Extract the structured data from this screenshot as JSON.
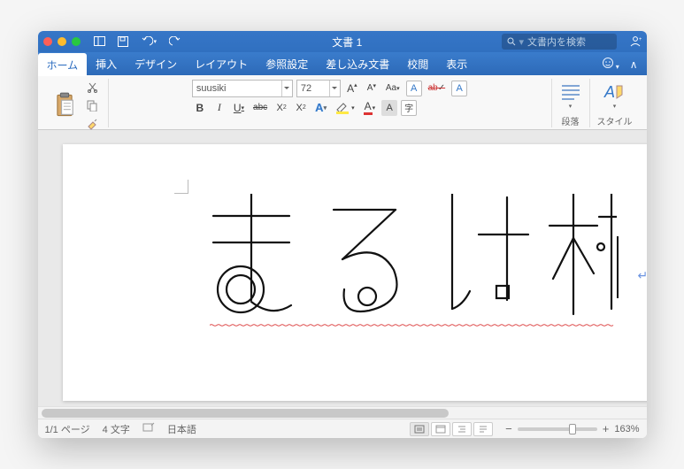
{
  "titlebar": {
    "title": "文書 1",
    "search_placeholder": "文書内を検索",
    "traffic": {
      "close": "#ff5f57",
      "min": "#febc2e",
      "max": "#28c840"
    }
  },
  "tabs": {
    "items": [
      "ホーム",
      "挿入",
      "デザイン",
      "レイアウト",
      "参照設定",
      "差し込み文書",
      "校閲",
      "表示"
    ],
    "active_index": 0
  },
  "ribbon": {
    "paste_group_label": "ペースト",
    "font_name": "suusiki",
    "font_size": "72",
    "bold": "B",
    "italic": "I",
    "underline": "U",
    "strike": "abc",
    "sub": "X₂",
    "sup": "X²",
    "incfont": "A",
    "decfont": "A",
    "caseA": "Aa",
    "clear": "A",
    "phonetic": "字",
    "textfx": "A",
    "highlight": "ab",
    "charbg": "A",
    "fontcolor": "A",
    "shade": "A",
    "charborder": "A",
    "para_label": "段落",
    "styles_label": "スタイル"
  },
  "document": {
    "font_display": "suusiki",
    "text": "まるけ村"
  },
  "status": {
    "page": "1/1 ページ",
    "chars": "4 文字",
    "lang": "日本語",
    "zoom": "163%"
  }
}
